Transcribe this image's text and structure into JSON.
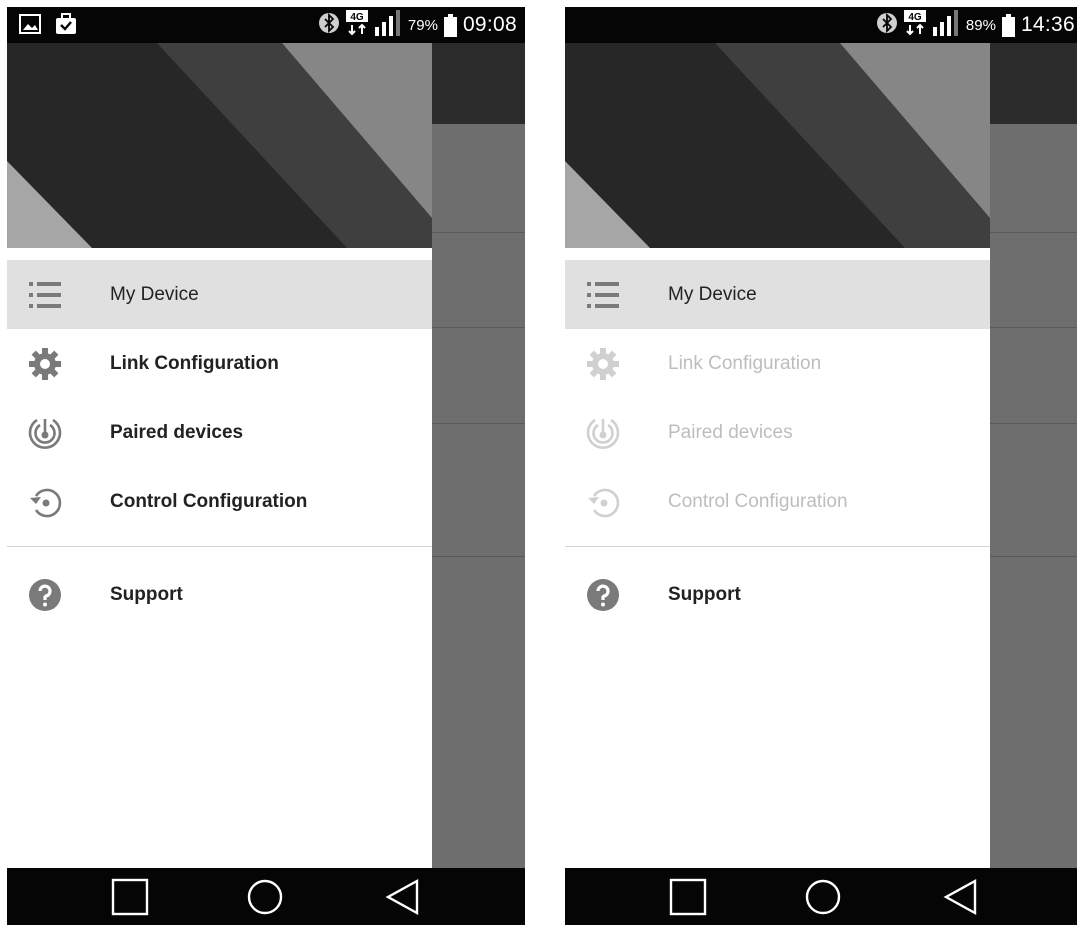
{
  "screens": [
    {
      "status_bar": {
        "battery_percent": "79%",
        "clock": "09:08",
        "notification_icons": [
          "image-icon",
          "briefcase-check-icon"
        ],
        "system_icons": [
          "bluetooth-icon",
          "4g-icon",
          "signal-icon",
          "battery-icon"
        ]
      },
      "menu": [
        {
          "label": "My Device",
          "icon": "list-icon",
          "state": "selected"
        },
        {
          "label": "Link Configuration",
          "icon": "gear-icon",
          "state": "enabled"
        },
        {
          "label": "Paired devices",
          "icon": "radar-icon",
          "state": "enabled"
        },
        {
          "label": "Control Configuration",
          "icon": "restore-icon",
          "state": "enabled"
        },
        {
          "label": "Support",
          "icon": "help-icon",
          "state": "enabled"
        }
      ]
    },
    {
      "status_bar": {
        "battery_percent": "89%",
        "clock": "14:36",
        "notification_icons": [],
        "system_icons": [
          "bluetooth-icon",
          "4g-icon",
          "signal-icon",
          "battery-icon"
        ]
      },
      "menu": [
        {
          "label": "My Device",
          "icon": "list-icon",
          "state": "selected"
        },
        {
          "label": "Link Configuration",
          "icon": "gear-icon",
          "state": "disabled"
        },
        {
          "label": "Paired devices",
          "icon": "radar-icon",
          "state": "disabled"
        },
        {
          "label": "Control Configuration",
          "icon": "restore-icon",
          "state": "disabled"
        },
        {
          "label": "Support",
          "icon": "help-icon",
          "state": "enabled"
        }
      ]
    }
  ],
  "network_label": "4G",
  "navigation_bar": [
    "recent-apps-icon",
    "home-icon",
    "back-icon"
  ],
  "colors": {
    "selected_row": "#e0e0e0",
    "disabled_text": "#bdbdbd",
    "scrim": "#6e6e6e",
    "bars": "#050505"
  }
}
